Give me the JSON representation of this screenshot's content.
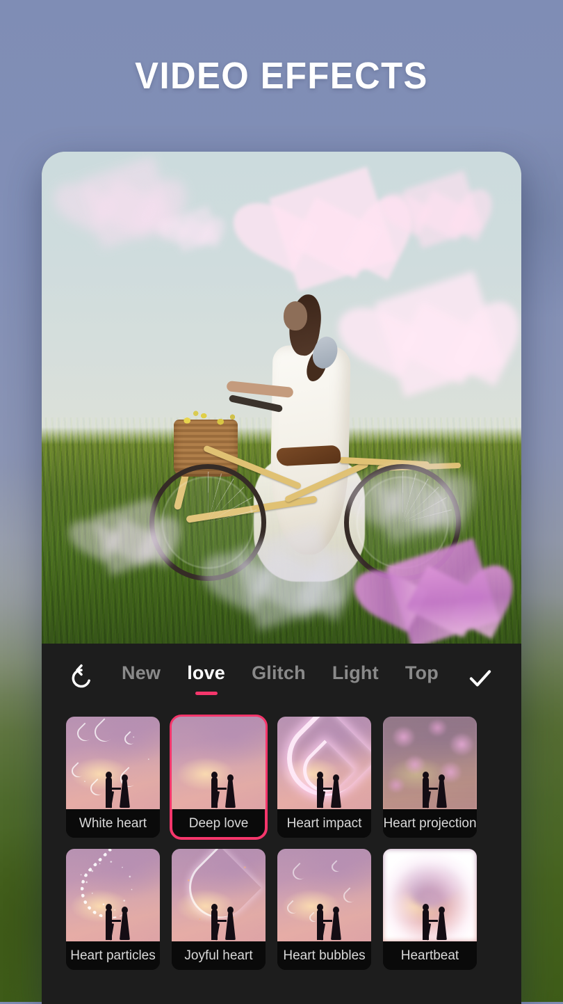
{
  "header": {
    "title": "VIDEO EFFECTS"
  },
  "preview": {
    "description": "Woman in white dress walking a yellow bicycle through a meadow at golden hour with pink heart overlays"
  },
  "toolbar": {
    "reset_icon": "reset-undo-icon",
    "confirm_icon": "check-icon",
    "tabs": [
      {
        "label": "New",
        "active": false
      },
      {
        "label": "love",
        "active": true
      },
      {
        "label": "Glitch",
        "active": false
      },
      {
        "label": "Light",
        "active": false
      },
      {
        "label": "Top",
        "active": false
      }
    ]
  },
  "effects": {
    "selected": "Deep love",
    "items": [
      {
        "label": "White heart",
        "selected": false
      },
      {
        "label": "Deep love",
        "selected": true
      },
      {
        "label": "Heart impact",
        "selected": false
      },
      {
        "label": "Heart projection",
        "selected": false
      },
      {
        "label": "Heart particles",
        "selected": false
      },
      {
        "label": "Joyful heart",
        "selected": false
      },
      {
        "label": "Heart bubbles",
        "selected": false
      },
      {
        "label": "Heartbeat",
        "selected": false
      }
    ]
  },
  "colors": {
    "accent_pink": "#f5366b",
    "panel_dark": "#1d1d1d",
    "tile_label_bg": "#0a0a0a",
    "tab_inactive": "#8a8a8a",
    "tab_active": "#ffffff",
    "backdrop_sky": "#7f8db5",
    "backdrop_grass": "#3e5c18"
  }
}
